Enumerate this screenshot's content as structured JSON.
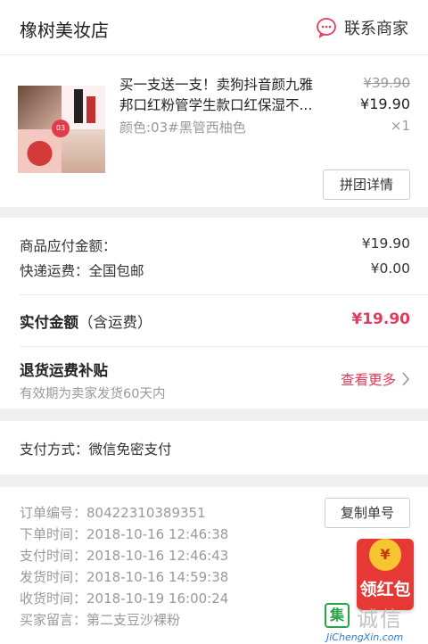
{
  "store": {
    "name": "橡树美妆店",
    "contact_label": "联系商家"
  },
  "product": {
    "title": "买一支送一支！卖狗抖音颜九雅邦口红粉管学生款口红保湿不...",
    "variant": "颜色:03#黑管西柚色",
    "original_price": "¥39.90",
    "price": "¥19.90",
    "quantity": "×1",
    "thumb_badge": "03",
    "group_button": "拼团详情"
  },
  "amounts": {
    "goods_label": "商品应付金额：",
    "goods_value": "¥19.90",
    "shipping_label": "快递运费：全国包邮",
    "shipping_value": "¥0.00",
    "total_label": "实付金额",
    "total_suffix": "（含运费）",
    "total_value": "¥19.90",
    "subsidy_title": "退货运费补贴",
    "subsidy_desc": "有效期为卖家发货60天内",
    "more_label": "查看更多"
  },
  "payment": {
    "text": "支付方式：微信免密支付"
  },
  "order": {
    "copy_button": "复制单号",
    "lines": [
      {
        "label": "订单编号：",
        "value": "80422310389351"
      },
      {
        "label": "下单时间：",
        "value": "2018-10-16  12:46:38"
      },
      {
        "label": "支付时间：",
        "value": "2018-10-16  12:46:43"
      },
      {
        "label": "发货时间：",
        "value": "2018-10-16  14:59:38"
      },
      {
        "label": "收货时间：",
        "value": "2018-10-19  16:00:24"
      },
      {
        "label": "买家留言：",
        "value": "第二支豆沙裸粉"
      }
    ]
  },
  "redpack": {
    "coin": "¥",
    "label": "领红包"
  },
  "watermark": {
    "mark": "集",
    "text": "诚信",
    "url": "JiChengXin.com"
  },
  "colors": {
    "accent": "#e23b5b",
    "background": "#efefef"
  }
}
